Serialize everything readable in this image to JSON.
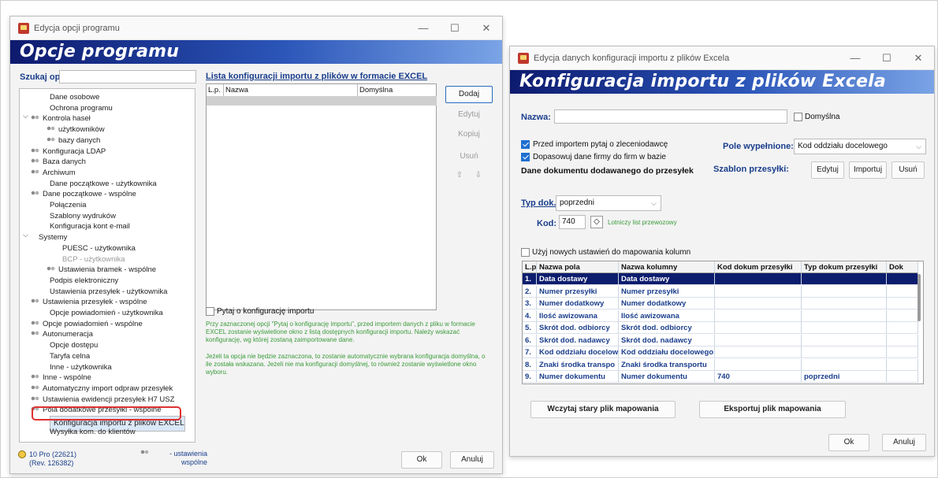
{
  "left_window": {
    "title": "Edycja opcji programu",
    "banner": "Opcje programu",
    "search_label": "Szukaj opcji:",
    "tree": [
      "Dane osobowe",
      "Ochrona programu",
      "Kontrola haseł",
      "użytkowników",
      "bazy danych",
      "Konfiguracja LDAP",
      "Baza danych",
      "Archiwum",
      "Dane początkowe - użytkownika",
      "Dane początkowe - wspólne",
      "Połączenia",
      "Szablony wydruków",
      "Konfiguracja kont e-mail",
      "Systemy",
      "PUESC - użytkownika",
      "BCP - użytkownika",
      "Ustawienia bramek - wspólne",
      "Podpis elektroniczny",
      "Ustawienia przesyłek - użytkownika",
      "Ustawienia przesyłek - wspólne",
      "Opcje powiadomień - użytkownika",
      "Opcje powiadomień - wspólne",
      "Autonumeracja",
      "Opcje dostępu",
      "Taryfa celna",
      "Inne - użytkownika",
      "Inne - wspólne",
      "Automatyczny import odpraw przesyłek",
      "Ustawienia ewidencji przesyłek H7 USZ",
      "Pola dodatkowe przesyłki - wspólne",
      "Konfiguracja importu z plików EXCEL",
      "Wysyłka kom. do klientów"
    ],
    "list_title": "Lista konfiguracji importu z plików w formacie EXCEL",
    "list_headers": [
      "L.p.",
      "Nazwa",
      "Domyślna"
    ],
    "buttons": {
      "add": "Dodaj",
      "edit": "Edytuj",
      "copy": "Kopiuj",
      "delete": "Usuń",
      "up": "⇧",
      "down": "⇩",
      "ok": "Ok",
      "cancel": "Anuluj"
    },
    "ask_checkbox": "Pytaj o konfigurację importu",
    "note1": "Przy zaznaczonej opcji \"Pytaj o konfigurację importu\", przed importem danych z pliku w formacie EXCEL zostanie wyświetlone okno z listą dostępnych konfiguracji importu. Należy wskazać konfigurację, wg której zostaną zaimportowane dane.",
    "note2": "Jeżeli ta opcja nie będzie zaznaczona, to zostanie automatycznie wybrana konfiguracja domyślna, o ile została wskazana. Jeżeli nie ma konfiguracji domyślnej, to również zostanie wyświetlone okno wyboru.",
    "version": "10 Pro (22621)",
    "revision": "(Rev. 126382)",
    "legend": "- ustawienia wspólne"
  },
  "right_window": {
    "title": "Edycja danych konfiguracji importu z plików Excela",
    "banner": "Konfiguracja importu z plików Excela",
    "name_label": "Nazwa:",
    "name_value": "",
    "default_label": "Domyślna",
    "cb_ask_client": "Przed importem pytaj o zleceniodawcę",
    "cb_match": "Dopasowuj dane firmy do firm w bazie",
    "fill_field_label": "Pole wypełnione:",
    "fill_field_value": "Kod oddziału docelowego",
    "doc_section": "Dane dokumentu dodawanego do przesyłek",
    "template_label": "Szablon przesyłki:",
    "edit": "Edytuj",
    "import": "Importuj",
    "delete": "Usuń",
    "doc_type_label": "Typ dok.:",
    "doc_type_value": "poprzedni",
    "code_label": "Kod:",
    "code_value": "740",
    "code_desc": "Lotniczy list przewozowy",
    "new_map_cb": "Użyj nowych ustawień do mapowania kolumn",
    "map_headers": [
      "L.p.",
      "Nazwa pola",
      "Nazwa kolumny",
      "Kod dokum przesyłki",
      "Typ dokum przesyłki",
      "Dok"
    ],
    "map_rows": [
      [
        "1.",
        "Data dostawy",
        "Data dostawy",
        "",
        ""
      ],
      [
        "2.",
        "Numer przesyłki",
        "Numer przesyłki",
        "",
        ""
      ],
      [
        "3.",
        "Numer dodatkowy",
        "Numer dodatkowy",
        "",
        ""
      ],
      [
        "4.",
        "Ilość awizowana",
        "Ilość awizowana",
        "",
        ""
      ],
      [
        "5.",
        "Skrót dod. odbiorcy",
        "Skrót dod. odbiorcy",
        "",
        ""
      ],
      [
        "6.",
        "Skrót dod. nadawcy",
        "Skrót dod. nadawcy",
        "",
        ""
      ],
      [
        "7.",
        "Kod oddziału docelow",
        "Kod oddziału docelowego",
        "",
        ""
      ],
      [
        "8.",
        "Znaki środka transpo",
        "Znaki środka transportu",
        "",
        ""
      ],
      [
        "9.",
        "Numer dokumentu",
        "Numer dokumentu",
        "740",
        "poprzedni"
      ]
    ],
    "load_btn": "Wczytaj stary plik mapowania",
    "export_btn": "Eksportuj plik mapowania",
    "ok": "Ok",
    "cancel": "Anuluj"
  },
  "colors": {
    "accent": "#1e6fd0",
    "banner_dark": "#0d1a6e",
    "note_green": "#3a9b3a",
    "highlight_red": "#e03030"
  }
}
